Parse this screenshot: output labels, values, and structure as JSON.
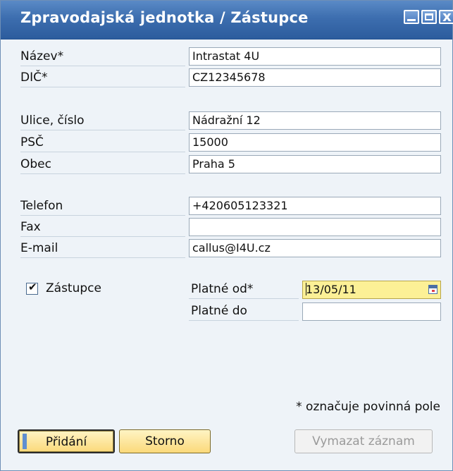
{
  "window": {
    "title": "Zpravodajská jednotka / Zástupce"
  },
  "form": {
    "fields": [
      {
        "label": "Název*",
        "value": "Intrastat 4U"
      },
      {
        "label": "DIČ*",
        "value": "CZ12345678"
      },
      {
        "label": "Ulice, číslo",
        "value": "Nádražní 12"
      },
      {
        "label": "PSČ",
        "value": "15000"
      },
      {
        "label": "Obec",
        "value": "Praha 5"
      },
      {
        "label": "Telefon",
        "value": "+420605123321"
      },
      {
        "label": "Fax",
        "value": ""
      },
      {
        "label": "E-mail",
        "value": "callus@I4U.cz"
      }
    ],
    "representative": {
      "checkbox_label": "Zástupce",
      "checked": true,
      "valid_from_label": "Platné od*",
      "valid_from_value": "13/05/11",
      "valid_to_label": "Platné do",
      "valid_to_value": ""
    },
    "required_note": "* označuje povinná pole"
  },
  "buttons": {
    "add": "Přidání",
    "cancel": "Storno",
    "delete": "Vymazat záznam"
  },
  "icons": {
    "checkmark": "✔",
    "calendar": "calendar-icon"
  }
}
